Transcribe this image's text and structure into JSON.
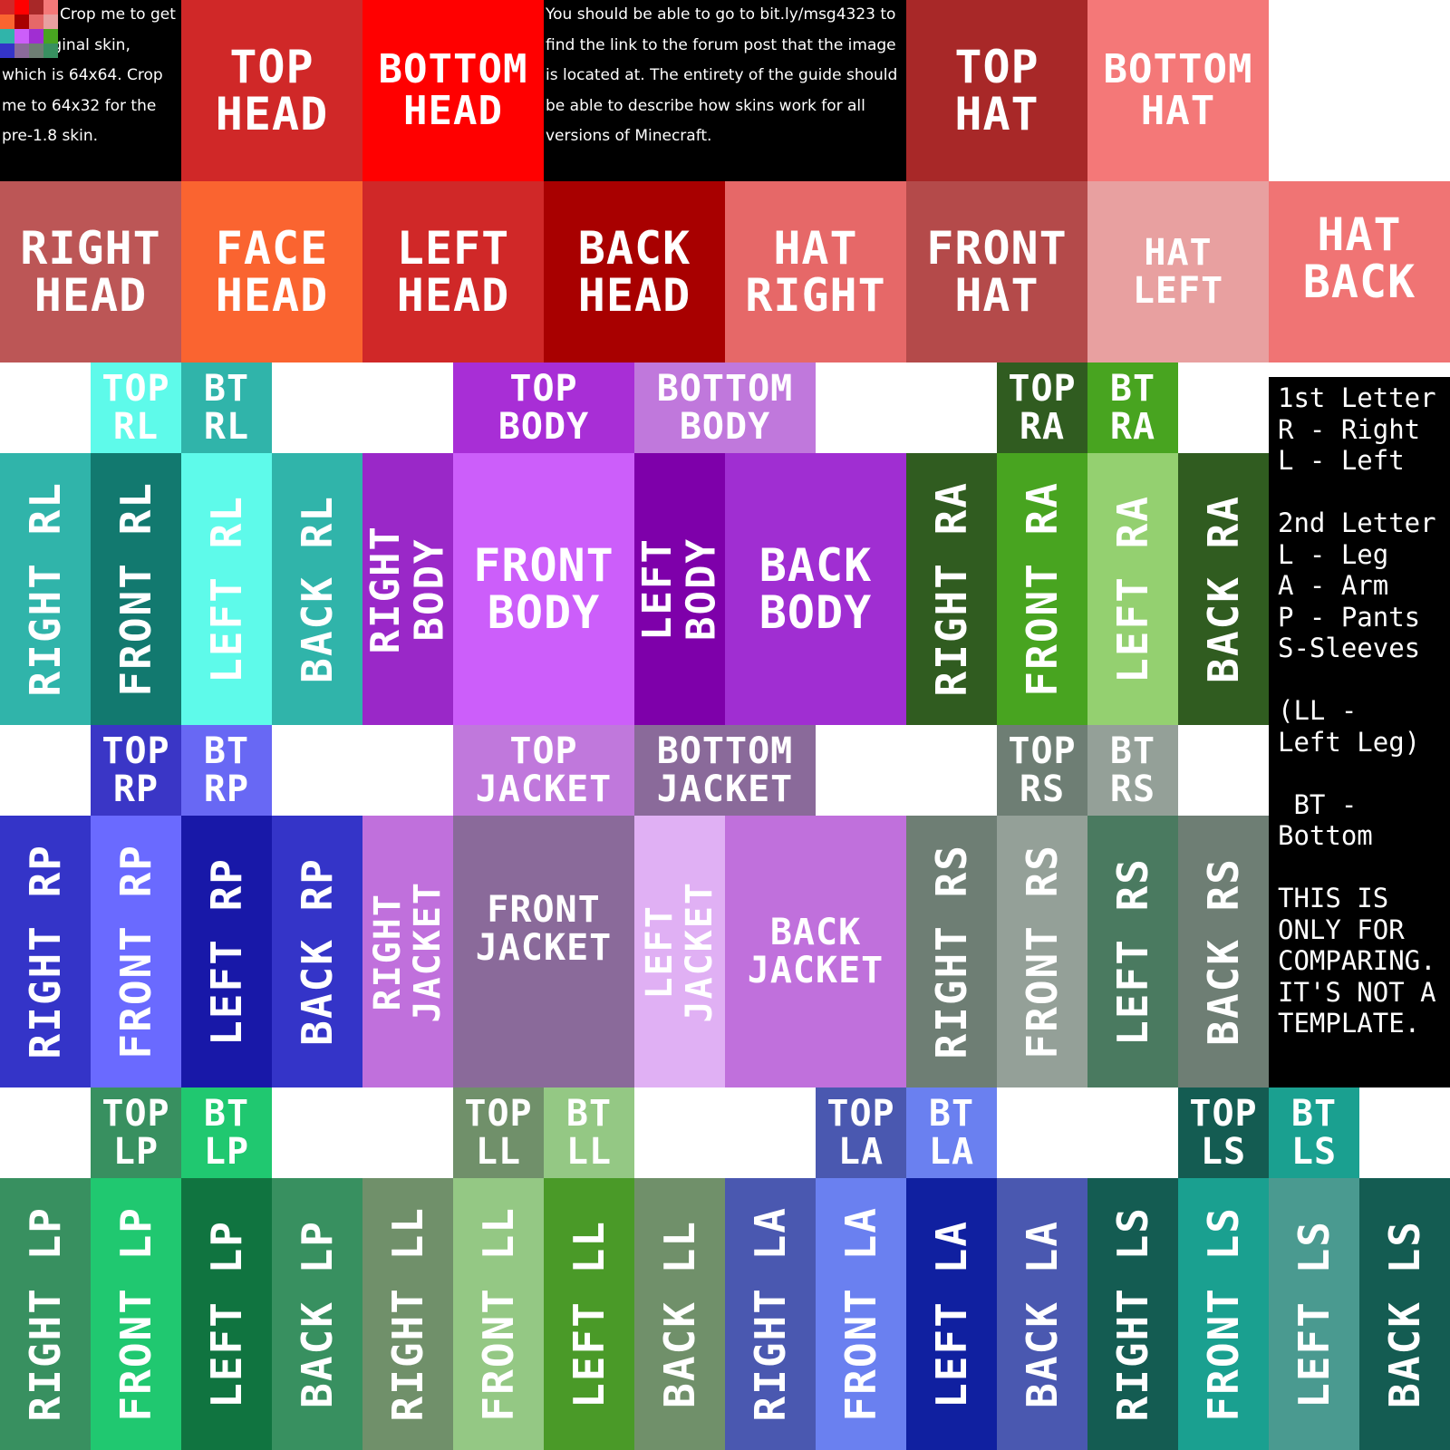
{
  "skin_map": {
    "top_left_note": "Crop me to get the original skin, which is 64x64. Crop me to 64x32 for the pre-1.8 skin.",
    "link_note": "You should be able to go to bit.ly/msg4323 to find the link to the forum post that the image is located at. The entirety of the guide should be able to describe how skins work for all versions of Minecraft.",
    "legend": "1st Letter\nR - Right\nL - Left\n\n2nd Letter\nL - Leg\nA - Arm\nP - Pants\nS-Sleeves\n\n(LL -\nLeft Leg)\n\n BT -\nBottom\n\nTHIS IS\nONLY FOR\nCOMPARING.\nIT'S NOT A\nTEMPLATE.",
    "regions": {
      "top_head": "TOP\nHEAD",
      "bottom_head": "BOTTOM\nHEAD",
      "top_hat": "TOP\nHAT",
      "bottom_hat": "BOTTOM\nHAT",
      "right_head": "RIGHT\nHEAD",
      "face_head": "FACE\nHEAD",
      "left_head": "LEFT\nHEAD",
      "back_head": "BACK\nHEAD",
      "hat_right": "HAT\nRIGHT",
      "front_hat": "FRONT\nHAT",
      "hat_left": "HAT\nLEFT",
      "hat_back": "HAT\nBACK",
      "top_rl": "TOP\nRL",
      "bt_rl": "BT\nRL",
      "top_body": "TOP\nBODY",
      "bottom_body": "BOTTOM\nBODY",
      "top_ra": "TOP\nRA",
      "bt_ra": "BT\nRA",
      "right_rl": "RIGHT RL",
      "front_rl": "FRONT RL",
      "left_rl": "LEFT RL",
      "back_rl": "BACK RL",
      "right_body": "RIGHT\nBODY",
      "front_body": "FRONT\nBODY",
      "left_body": "LEFT\nBODY",
      "back_body": "BACK\nBODY",
      "right_ra": "RIGHT RA",
      "front_ra": "FRONT RA",
      "left_ra": "LEFT RA",
      "back_ra": "BACK RA",
      "top_rp": "TOP\nRP",
      "bt_rp": "BT\nRP",
      "top_jacket": "TOP\nJACKET",
      "bottom_jacket": "BOTTOM\nJACKET",
      "top_rs": "TOP\nRS",
      "bt_rs": "BT\nRS",
      "right_rp": "RIGHT RP",
      "front_rp": "FRONT RP",
      "left_rp": "LEFT RP",
      "back_rp": "BACK RP",
      "right_jacket": "RIGHT\nJACKET",
      "front_jacket": "FRONT\nJACKET",
      "left_jacket": "LEFT\nJACKET",
      "back_jacket": "BACK\nJACKET",
      "right_rs": "RIGHT RS",
      "front_rs": "FRONT RS",
      "left_rs": "LEFT RS",
      "back_rs": "BACK RS",
      "top_lp": "TOP\nLP",
      "bt_lp": "BT\nLP",
      "top_ll": "TOP\nLL",
      "bt_ll": "BT\nLL",
      "top_la": "TOP\nLA",
      "bt_la": "BT\nLA",
      "top_ls": "TOP\nLS",
      "bt_ls": "BT\nLS",
      "right_lp": "RIGHT LP",
      "front_lp": "FRONT LP",
      "left_lp": "LEFT LP",
      "back_lp": "BACK LP",
      "right_ll": "RIGHT LL",
      "front_ll": "FRONT LL",
      "left_ll": "LEFT LL",
      "back_ll": "BACK LL",
      "right_la": "RIGHT LA",
      "front_la": "FRONT LA",
      "left_la": "LEFT LA",
      "back_la": "BACK LA",
      "right_ls": "RIGHT LS",
      "front_ls": "FRONT LS",
      "left_ls": "LEFT LS",
      "back_ls": "BACK LS"
    }
  },
  "colors": {
    "note_bg": "#000000",
    "legend_bg": "#000000",
    "text": "#ffffff",
    "top_head": "#d02828",
    "bottom_head": "#ff0000",
    "top_hat": "#a82828",
    "bottom_hat": "#f47878",
    "right_head": "#bc5656",
    "face_head": "#fa6430",
    "left_head": "#d02828",
    "back_head": "#a80000",
    "hat_right": "#e66868",
    "front_hat": "#b44a4a",
    "hat_left": "#e8a0a0",
    "hat_back": "#f07474",
    "top_rl": "#5efaea",
    "bt_rl": "#30b4aa",
    "top_body": "#a82ed6",
    "bottom_body": "#c078dc",
    "top_ra": "#305c20",
    "bt_ra": "#48a420",
    "right_rl": "#30b4aa",
    "front_rl": "#12796f",
    "left_rl": "#5efaea",
    "back_rl": "#30b4aa",
    "right_body": "#9a28c8",
    "front_body": "#cc5efa",
    "left_body": "#7e00aa",
    "back_body": "#a02ed2",
    "right_ra": "#305c20",
    "front_ra": "#48a420",
    "left_ra": "#94d070",
    "back_ra": "#305c20",
    "top_rp": "#3a36c6",
    "bt_rp": "#6868f4",
    "top_jacket": "#c078dc",
    "bottom_jacket": "#8a6a9a",
    "top_rs": "#6e7e74",
    "bt_rs": "#94a098",
    "right_rp": "#3434c8",
    "front_rp": "#6a6aff",
    "left_rp": "#1818a8",
    "back_rp": "#3434c8",
    "right_jacket": "#c070dc",
    "front_jacket": "#8a6a9a",
    "left_jacket": "#e0b0f4",
    "back_jacket": "#c070dc",
    "right_rs": "#6e7e74",
    "front_rs": "#94a098",
    "left_rs": "#4a7a60",
    "back_rs": "#6e7e74",
    "top_lp": "#389060",
    "bt_lp": "#20c870",
    "top_ll": "#70906a",
    "bt_ll": "#94c884",
    "top_la": "#4a58b0",
    "bt_la": "#6a80f0",
    "top_ls": "#145c52",
    "bt_ls": "#1aa090",
    "right_lp": "#389060",
    "front_lp": "#20c870",
    "left_lp": "#107440",
    "back_lp": "#389060",
    "right_ll": "#70906a",
    "front_ll": "#94c884",
    "left_ll": "#4a9a28",
    "back_ll": "#70906a",
    "right_la": "#4a58b0",
    "front_la": "#6a80f0",
    "left_la": "#1020a0",
    "back_la": "#4a58b0",
    "right_ls": "#145c52",
    "front_ls": "#1aa090",
    "left_ls": "#4a9a90",
    "back_ls": "#145c52"
  },
  "thumbnail_icon": "skin-thumbnail-icon"
}
